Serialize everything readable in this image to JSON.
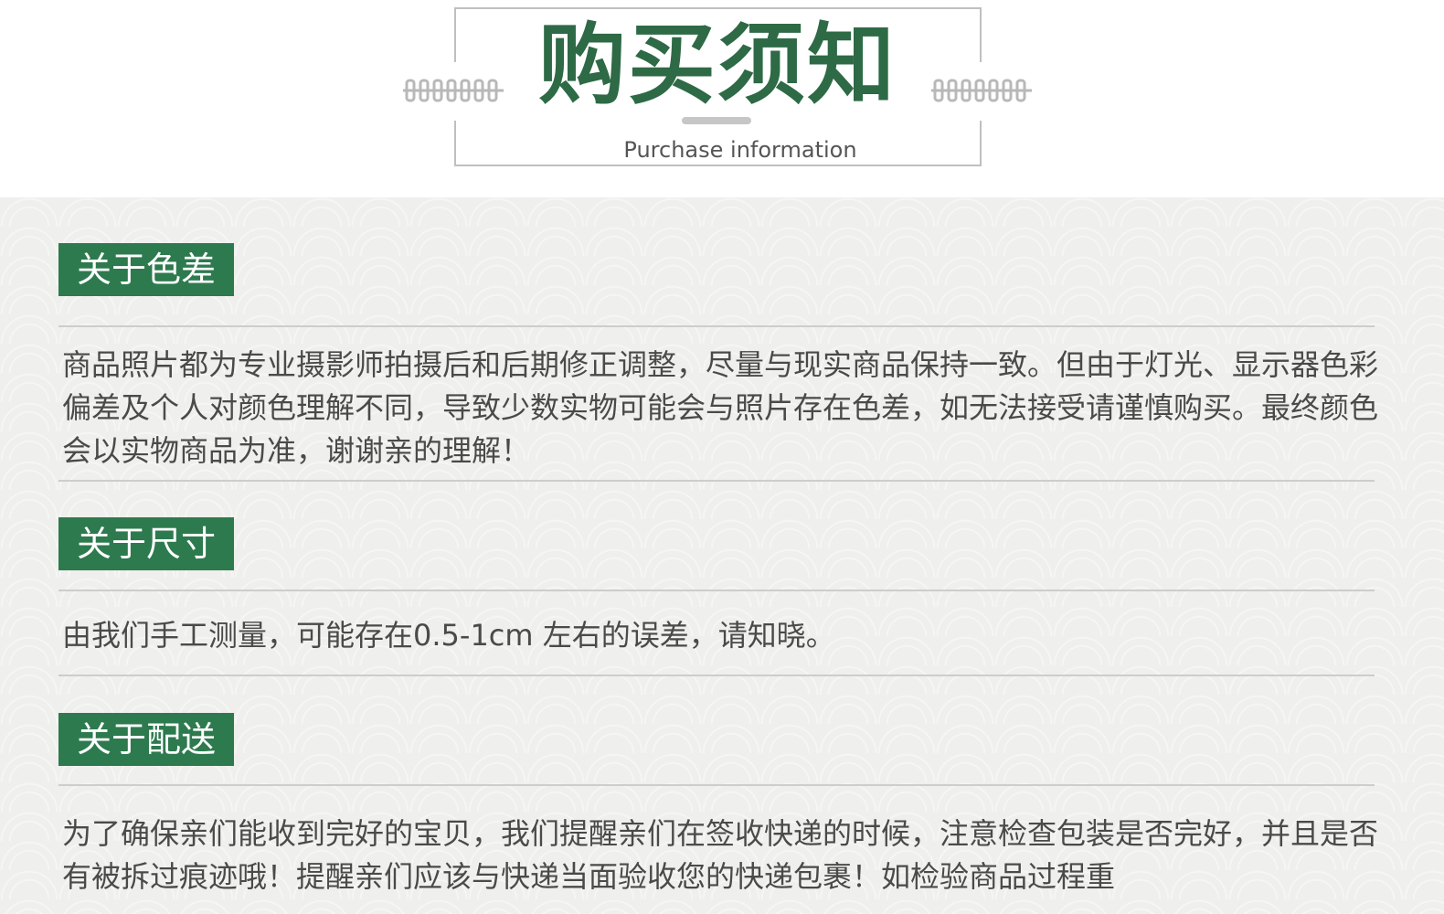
{
  "header": {
    "title": "购买须知",
    "subtitle": "Purchase information",
    "colors": {
      "title": "#2d6a45",
      "frame": "#bfbfbf",
      "ornament": "#b8b8b8"
    },
    "ornament_icon": "spiral-coil-ornament"
  },
  "sections": [
    {
      "tag": "关于色差",
      "text": "商品照片都为专业摄影师拍摄后和后期修正调整，尽量与现实商品保持一致。但由于灯光、显示器色彩偏差及个人对颜色理解不同，导致少数实物可能会与照片存在色差，如无法接受请谨慎购买。最终颜色会以实物商品为准，谢谢亲的理解！"
    },
    {
      "tag": "关于尺寸",
      "text": "由我们手工测量，可能存在0.5-1cm 左右的误差，请知晓。"
    },
    {
      "tag": "关于配送",
      "text": "为了确保亲们能收到完好的宝贝，我们提醒亲们在签收快递的时候，注意检查包装是否完好，并且是否有被拆过痕迹哦！提醒亲们应该与快递当面验收您的快递包裹！如检验商品过程重"
    }
  ],
  "colors": {
    "tag_background": "#2d7a4e",
    "tag_text": "#ffffff",
    "body_text": "#4a4a4a",
    "panel_background": "#efefed"
  }
}
